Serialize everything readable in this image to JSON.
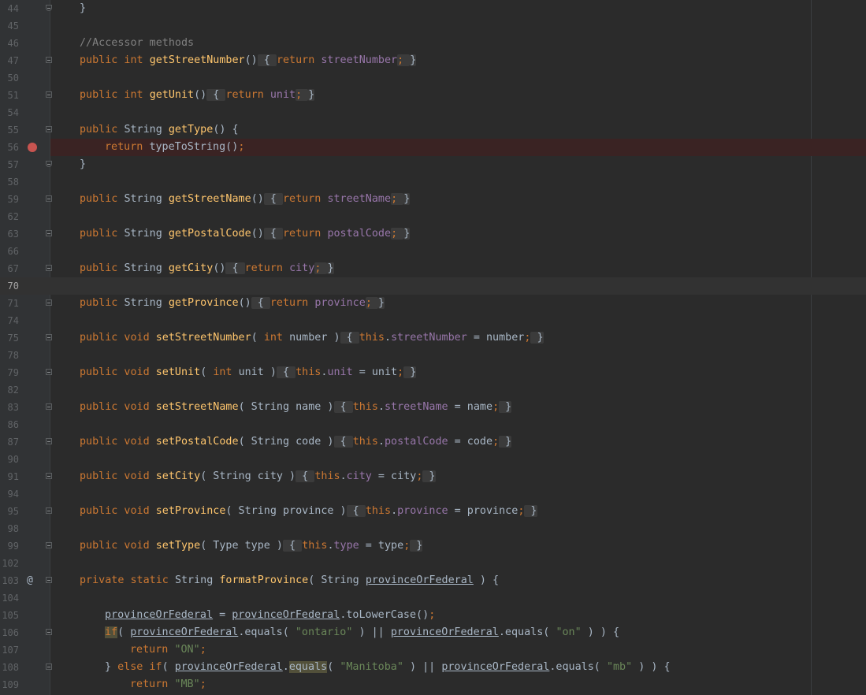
{
  "editor": {
    "language": "Java",
    "colors": {
      "background": "#2b2b2b",
      "keyword": "#cc7832",
      "method": "#ffc66d",
      "field": "#9876aa",
      "string": "#6a8759",
      "comment": "#808080",
      "breakpoint": "#c75450"
    },
    "lines": [
      {
        "n": "44",
        "t": "}"
      },
      {
        "n": "45",
        "t": ""
      },
      {
        "n": "46",
        "t": "//Accessor methods"
      },
      {
        "n": "47",
        "t": "public int getStreetNumber() { return streetNumber; }"
      },
      {
        "n": "50",
        "t": ""
      },
      {
        "n": "51",
        "t": "public int getUnit() { return unit; }"
      },
      {
        "n": "54",
        "t": ""
      },
      {
        "n": "55",
        "t": "public String getType() {"
      },
      {
        "n": "56",
        "t": "return typeToString();"
      },
      {
        "n": "57",
        "t": "}"
      },
      {
        "n": "58",
        "t": ""
      },
      {
        "n": "59",
        "t": "public String getStreetName() { return streetName; }"
      },
      {
        "n": "62",
        "t": ""
      },
      {
        "n": "63",
        "t": "public String getPostalCode() { return postalCode; }"
      },
      {
        "n": "66",
        "t": ""
      },
      {
        "n": "67",
        "t": "public String getCity() { return city; }"
      },
      {
        "n": "70",
        "t": ""
      },
      {
        "n": "71",
        "t": "public String getProvince() { return province; }"
      },
      {
        "n": "74",
        "t": ""
      },
      {
        "n": "75",
        "t": "public void setStreetNumber( int number ) { this.streetNumber = number; }"
      },
      {
        "n": "78",
        "t": ""
      },
      {
        "n": "79",
        "t": "public void setUnit( int unit ) { this.unit = unit; }"
      },
      {
        "n": "82",
        "t": ""
      },
      {
        "n": "83",
        "t": "public void setStreetName( String name ) { this.streetName = name; }"
      },
      {
        "n": "86",
        "t": ""
      },
      {
        "n": "87",
        "t": "public void setPostalCode( String code ) { this.postalCode = code; }"
      },
      {
        "n": "90",
        "t": ""
      },
      {
        "n": "91",
        "t": "public void setCity( String city ) { this.city = city; }"
      },
      {
        "n": "94",
        "t": ""
      },
      {
        "n": "95",
        "t": "public void setProvince( String province ) { this.province = province; }"
      },
      {
        "n": "98",
        "t": ""
      },
      {
        "n": "99",
        "t": "public void setType( Type type ) { this.type = type; }"
      },
      {
        "n": "102",
        "t": ""
      },
      {
        "n": "103",
        "t": "private static String formatProvince( String provinceOrFederal ) {"
      },
      {
        "n": "104",
        "t": ""
      },
      {
        "n": "105",
        "t": "provinceOrFederal = provinceOrFederal.toLowerCase();"
      },
      {
        "n": "106",
        "t": "if( provinceOrFederal.equals( \"ontario\" ) || provinceOrFederal.equals( \"on\" ) ) {"
      },
      {
        "n": "107",
        "t": "return \"ON\";"
      },
      {
        "n": "108",
        "t": "} else if( provinceOrFederal.equals( \"Manitoba\" ) || provinceOrFederal.equals( \"mb\" ) ) {"
      },
      {
        "n": "109",
        "t": "return \"MB\";"
      }
    ],
    "current_line": "70",
    "breakpoint_line": "56",
    "override_marker": "@"
  }
}
